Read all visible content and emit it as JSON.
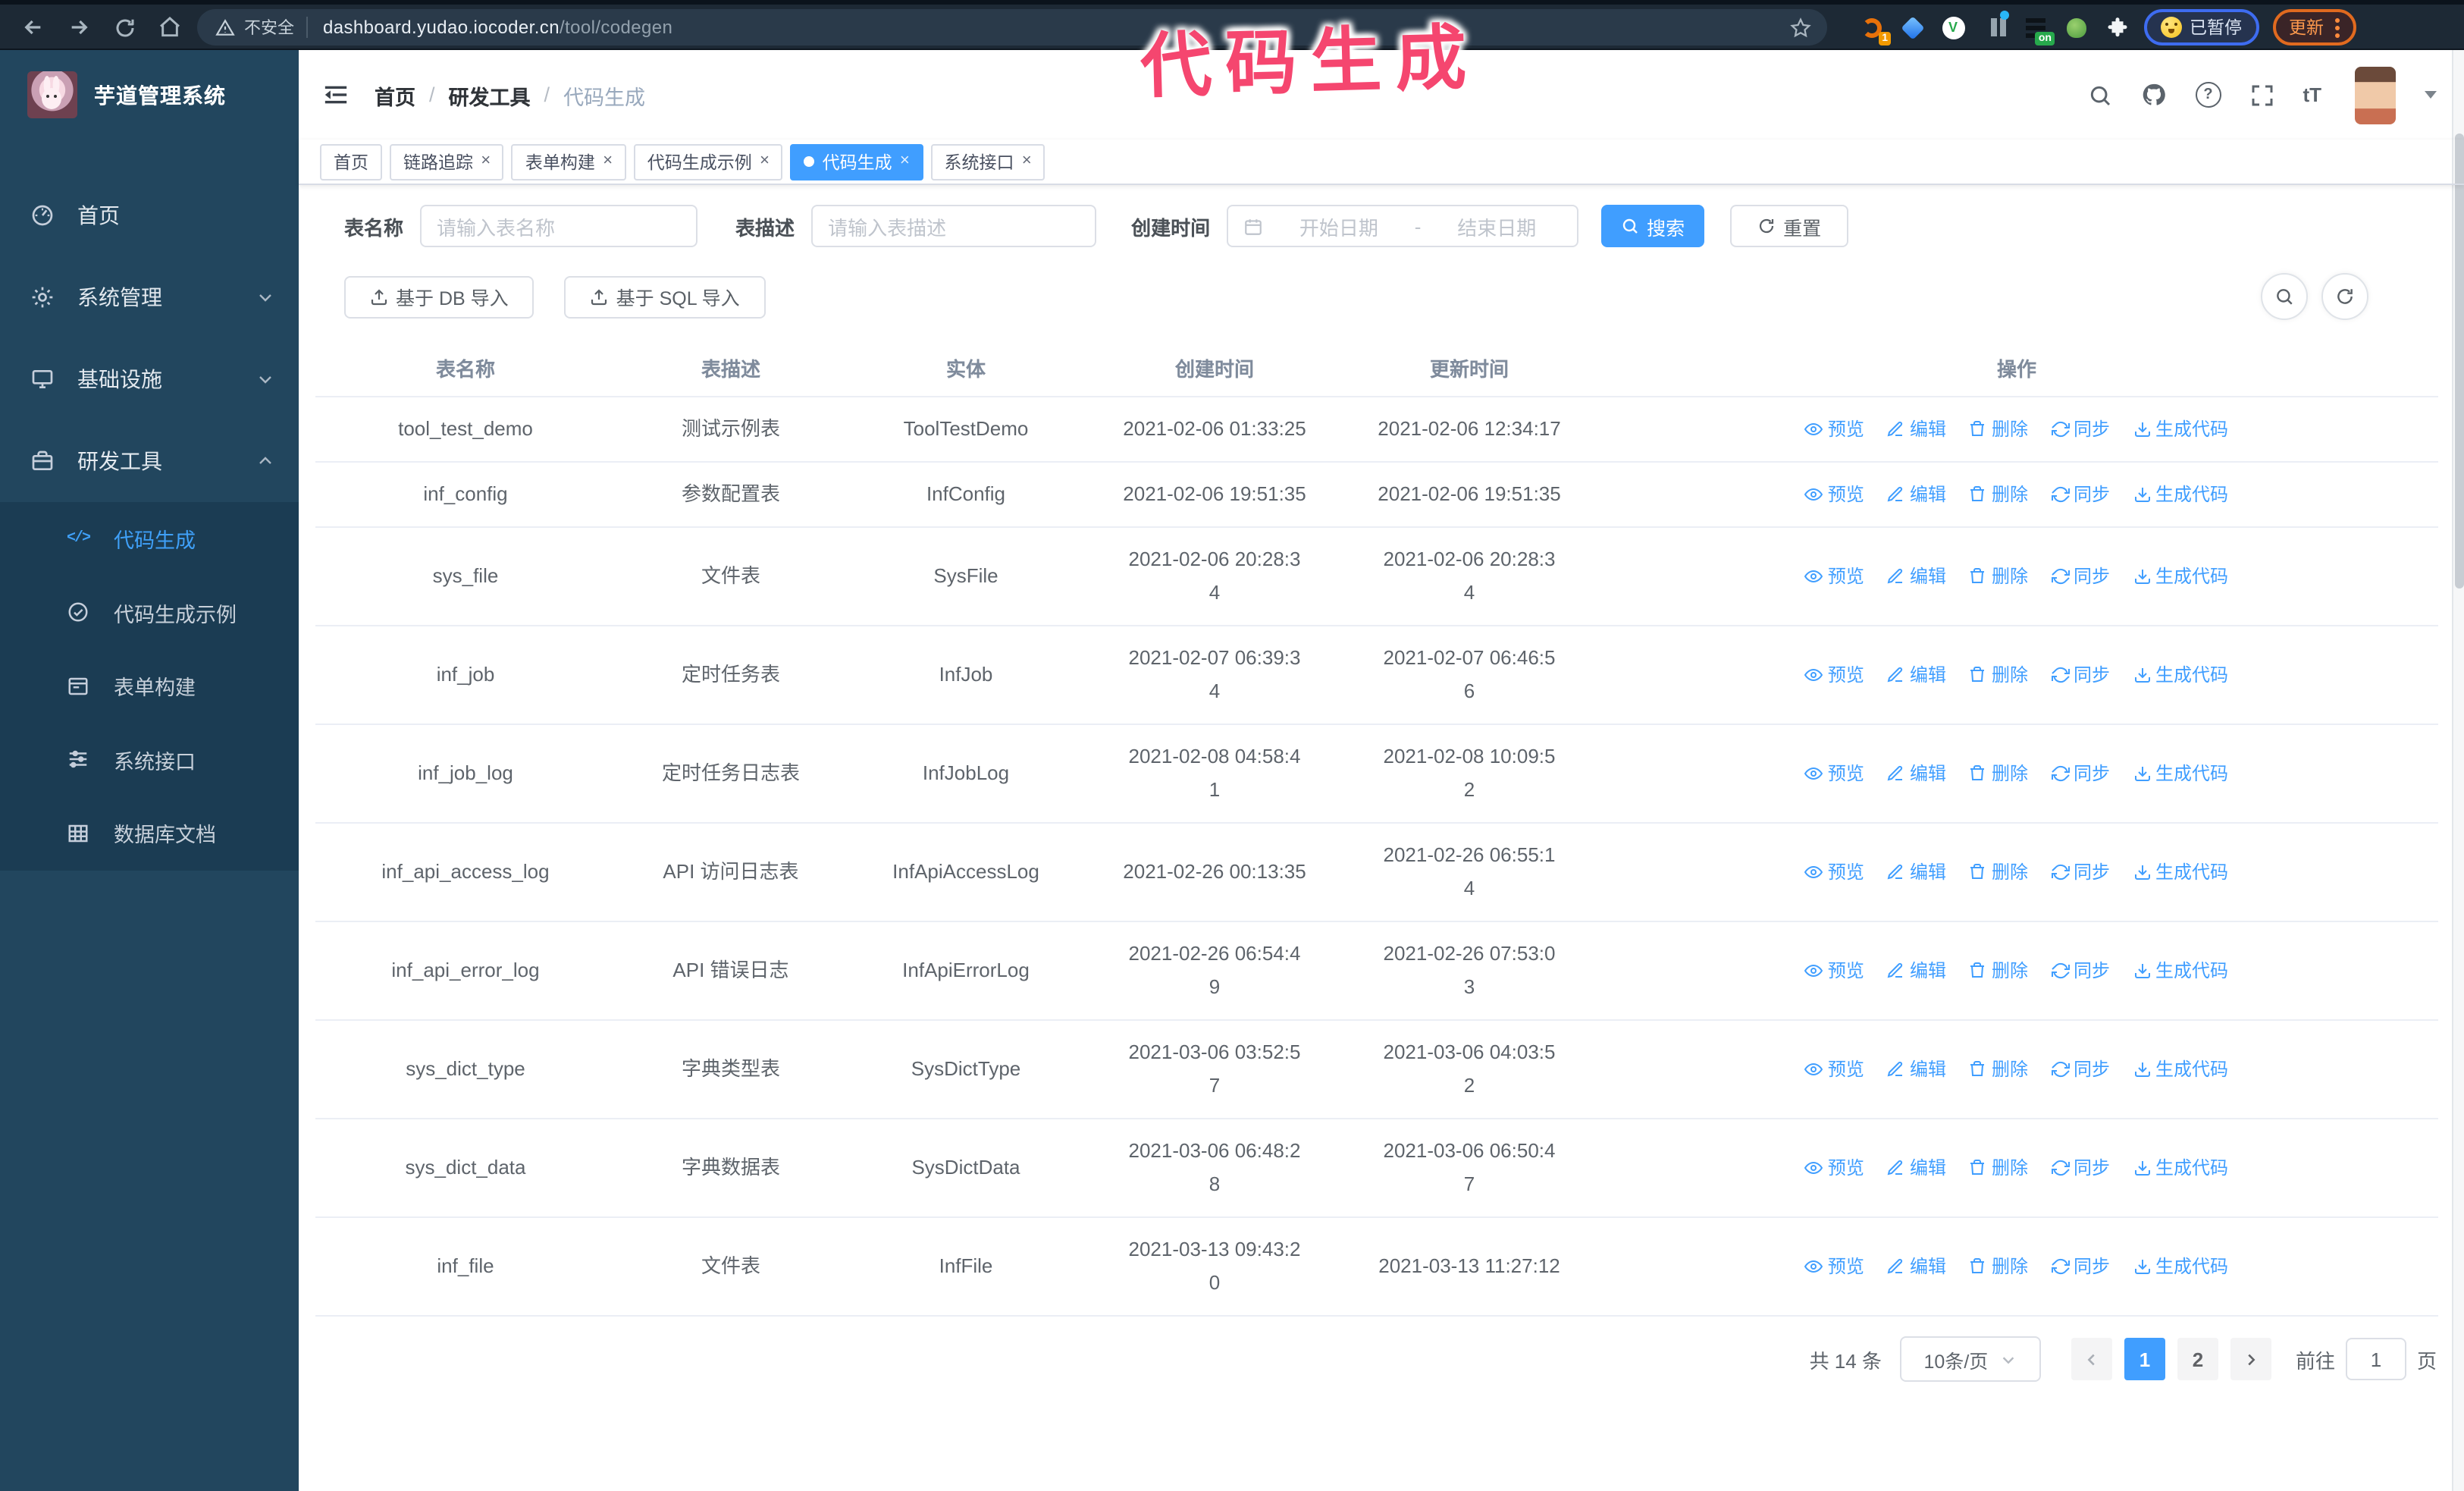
{
  "colors": {
    "accent": "#409eff",
    "annotation_pink": "#f5466f",
    "sidebar_bg": "#22465e",
    "submenu_bg": "#1b3c53",
    "tag_active": "#409eff",
    "browser_bar": "#1d2935"
  },
  "icons": {
    "back-icon": "left arrow",
    "forward-icon": "right arrow",
    "reload-icon": "circular arrow",
    "home-icon": "house",
    "warning-icon": "triangle !",
    "star-icon": "bookmark star",
    "puzzle-icon": "extensions",
    "search-icon": "magnifier",
    "github-icon": "octocat",
    "help-icon": "? circle",
    "fullscreen-icon": "corner brackets",
    "font-size-icon": "tT",
    "eye-icon": "preview",
    "pencil-icon": "edit",
    "trash-icon": "delete",
    "sync-icon": "two arrows",
    "download-icon": "arrow into tray",
    "calendar-icon": "calendar",
    "upload-icon": "arrow up from tray"
  },
  "browser": {
    "security_label": "不安全",
    "url_host": "dashboard.yudao.iocoder.cn",
    "url_path": "/tool/codegen",
    "extension_badge": "1",
    "extension_on_badge": "on",
    "paused_button": "已暂停",
    "update_button": "更新"
  },
  "annotation": {
    "text": "代码生成"
  },
  "sidebar": {
    "logo_title": "芋道管理系统",
    "items": [
      {
        "label": "首页"
      },
      {
        "label": "系统管理"
      },
      {
        "label": "基础设施"
      },
      {
        "label": "研发工具"
      }
    ],
    "submenu": [
      {
        "label": "代码生成",
        "active": true
      },
      {
        "label": "代码生成示例"
      },
      {
        "label": "表单构建"
      },
      {
        "label": "系统接口"
      },
      {
        "label": "数据库文档"
      }
    ]
  },
  "header": {
    "breadcrumb": [
      "首页",
      "研发工具",
      "代码生成"
    ]
  },
  "tags": [
    {
      "label": "首页",
      "closable": false,
      "active": false
    },
    {
      "label": "链路追踪",
      "closable": true,
      "active": false
    },
    {
      "label": "表单构建",
      "closable": true,
      "active": false
    },
    {
      "label": "代码生成示例",
      "closable": true,
      "active": false
    },
    {
      "label": "代码生成",
      "closable": true,
      "active": true
    },
    {
      "label": "系统接口",
      "closable": true,
      "active": false
    }
  ],
  "filters": {
    "table_name_label": "表名称",
    "table_name_placeholder": "请输入表名称",
    "table_desc_label": "表描述",
    "table_desc_placeholder": "请输入表描述",
    "create_time_label": "创建时间",
    "date_start_placeholder": "开始日期",
    "date_separator": "-",
    "date_end_placeholder": "结束日期",
    "search_label": "搜索",
    "reset_label": "重置"
  },
  "toolbar": {
    "import_db_label": "基于 DB 导入",
    "import_sql_label": "基于 SQL 导入"
  },
  "table": {
    "columns": [
      "表名称",
      "表描述",
      "实体",
      "创建时间",
      "更新时间",
      "操作"
    ],
    "actions": [
      "预览",
      "编辑",
      "删除",
      "同步",
      "生成代码"
    ],
    "rows": [
      {
        "name": "tool_test_demo",
        "desc": "测试示例表",
        "entity": "ToolTestDemo",
        "created": "2021-02-06 01:33:25",
        "updated": "2021-02-06 12:34:17"
      },
      {
        "name": "inf_config",
        "desc": "参数配置表",
        "entity": "InfConfig",
        "created": "2021-02-06 19:51:35",
        "updated": "2021-02-06 19:51:35"
      },
      {
        "name": "sys_file",
        "desc": "文件表",
        "entity": "SysFile",
        "created": "2021-02-06 20:28:3\n4",
        "updated": "2021-02-06 20:28:3\n4"
      },
      {
        "name": "inf_job",
        "desc": "定时任务表",
        "entity": "InfJob",
        "created": "2021-02-07 06:39:3\n4",
        "updated": "2021-02-07 06:46:5\n6"
      },
      {
        "name": "inf_job_log",
        "desc": "定时任务日志表",
        "entity": "InfJobLog",
        "created": "2021-02-08 04:58:4\n1",
        "updated": "2021-02-08 10:09:5\n2"
      },
      {
        "name": "inf_api_access_log",
        "desc": "API 访问日志表",
        "entity": "InfApiAccessLog",
        "created": "2021-02-26 00:13:35",
        "updated": "2021-02-26 06:55:1\n4"
      },
      {
        "name": "inf_api_error_log",
        "desc": "API 错误日志",
        "entity": "InfApiErrorLog",
        "created": "2021-02-26 06:54:4\n9",
        "updated": "2021-02-26 07:53:0\n3"
      },
      {
        "name": "sys_dict_type",
        "desc": "字典类型表",
        "entity": "SysDictType",
        "created": "2021-03-06 03:52:5\n7",
        "updated": "2021-03-06 04:03:5\n2"
      },
      {
        "name": "sys_dict_data",
        "desc": "字典数据表",
        "entity": "SysDictData",
        "created": "2021-03-06 06:48:2\n8",
        "updated": "2021-03-06 06:50:4\n7"
      },
      {
        "name": "inf_file",
        "desc": "文件表",
        "entity": "InfFile",
        "created": "2021-03-13 09:43:2\n0",
        "updated": "2021-03-13 11:27:12"
      }
    ]
  },
  "pagination": {
    "total": "共 14 条",
    "page_size": "10条/页",
    "pages": [
      {
        "label": "1",
        "active": true
      },
      {
        "label": "2",
        "active": false
      }
    ],
    "goto_label": "前往",
    "goto_value": "1",
    "page_label": "页"
  }
}
